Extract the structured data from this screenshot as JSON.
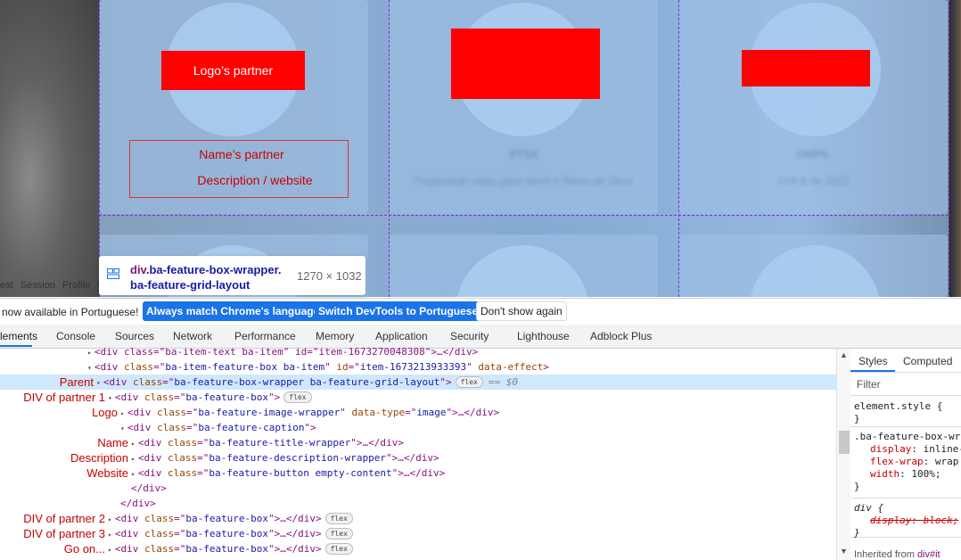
{
  "page": {
    "partners": [
      {
        "logo_label": "Logo’s partner",
        "name_label": "Name’s partner",
        "description_label": "Description / website",
        "blurred_name": "",
        "blurred_desc": ""
      },
      {
        "logo_label": "",
        "blurred_name": "PTSA",
        "blurred_desc": "Preparando vidas para servir o Reino de Deus"
      },
      {
        "logo_label": "",
        "blurred_name": "UNIPIL",
        "blurred_desc": "Unit & de 2022"
      }
    ],
    "highlight_color": "#ff0000"
  },
  "tooltip": {
    "tag": "div",
    "selector_line1": ".ba-feature-box-wrapper.",
    "selector_line2": "ba-feature-grid-layout",
    "dimensions": "1270 × 1032"
  },
  "browser_menu": [
    "est",
    "Session",
    "Profile",
    "Qu"
  ],
  "infobar": {
    "message": "now available in Portuguese!",
    "btn_match": "Always match Chrome's language",
    "btn_switch": "Switch DevTools to Portuguese",
    "btn_dismiss": "Don't show again"
  },
  "devtools_tabs": [
    "lements",
    "Console",
    "Sources",
    "Network",
    "Performance",
    "Memory",
    "Application",
    "Security",
    "Lighthouse",
    "Adblock Plus"
  ],
  "dom_tree": [
    {
      "label": "",
      "indent": 0,
      "tri": "▸",
      "code": "<div class=\"ba-item-text ba-item\" id=\"item-1673270048308\">…</div>"
    },
    {
      "label": "",
      "indent": 0,
      "tri": "▾",
      "tag_open": "<div",
      "attrs": [
        [
          "class",
          "ba-item-feature-box ba-item"
        ],
        [
          "id",
          "item-1673213933393"
        ],
        [
          "data-effect",
          null
        ]
      ],
      "close": ">"
    },
    {
      "label": "Parent",
      "indent": 1,
      "tri": "▾",
      "tag_open": "<div",
      "attrs": [
        [
          "class",
          "ba-feature-box-wrapper ba-feature-grid-layout"
        ]
      ],
      "close": ">",
      "pill": "flex",
      "eq": "== $0",
      "selected": true
    },
    {
      "label": "DIV of partner 1",
      "indent": 2,
      "tri": "▾",
      "tag_open": "<div",
      "attrs": [
        [
          "class",
          "ba-feature-box"
        ]
      ],
      "close": ">",
      "pill": "flex"
    },
    {
      "label": "Logo",
      "indent": 3,
      "tri": "▸",
      "tag_open": "<div",
      "attrs": [
        [
          "class",
          "ba-feature-image-wrapper"
        ],
        [
          "data-type",
          "image"
        ]
      ],
      "close": ">…</div>"
    },
    {
      "label": "",
      "indent": 3,
      "tri": "▾",
      "tag_open": "<div",
      "attrs": [
        [
          "class",
          "ba-feature-caption"
        ]
      ],
      "close": ">"
    },
    {
      "label": "Name",
      "indent": 4,
      "tri": "▸",
      "tag_open": "<div",
      "attrs": [
        [
          "class",
          "ba-feature-title-wrapper"
        ]
      ],
      "close": ">…</div>"
    },
    {
      "label": "Description",
      "indent": 4,
      "tri": "▸",
      "tag_open": "<div",
      "attrs": [
        [
          "class",
          "ba-feature-description-wrapper"
        ]
      ],
      "close": ">…</div>"
    },
    {
      "label": "Website",
      "indent": 4,
      "tri": "▸",
      "tag_open": "<div",
      "attrs": [
        [
          "class",
          "ba-feature-button empty-content"
        ]
      ],
      "close": ">…</div>"
    },
    {
      "label": "",
      "indent": 4,
      "tri": "",
      "closing": "</div>"
    },
    {
      "label": "",
      "indent": 3,
      "tri": "",
      "closing": "</div>"
    },
    {
      "label": "DIV of partner 2",
      "indent": 2,
      "tri": "▸",
      "tag_open": "<div",
      "attrs": [
        [
          "class",
          "ba-feature-box"
        ]
      ],
      "close": ">…</div>",
      "pill": "flex"
    },
    {
      "label": "DIV of partner 3",
      "indent": 2,
      "tri": "▸",
      "tag_open": "<div",
      "attrs": [
        [
          "class",
          "ba-feature-box"
        ]
      ],
      "close": ">…</div>",
      "pill": "flex"
    },
    {
      "label": "Go on...",
      "indent": 2,
      "tri": "▸",
      "tag_open": "<div",
      "attrs": [
        [
          "class",
          "ba-feature-box"
        ]
      ],
      "close": ">…</div>",
      "pill": "flex"
    }
  ],
  "styles_panel": {
    "tabs": [
      "Styles",
      "Computed"
    ],
    "filter_placeholder": "Filter",
    "rules": [
      {
        "selector": "element.style {",
        "props": [],
        "close": "}"
      },
      {
        "selector": ".ba-feature-box-wra",
        "props": [
          [
            "display",
            "inline-"
          ],
          [
            "flex-wrap",
            "wrap"
          ],
          [
            "width",
            "100%;"
          ]
        ],
        "close": "}"
      },
      {
        "selector": "div {",
        "props": [
          [
            "display",
            "block;",
            "struck"
          ]
        ],
        "close": "}",
        "italic": true
      }
    ],
    "inherited_label": "Inherited from",
    "inherited_link": "div#it"
  }
}
